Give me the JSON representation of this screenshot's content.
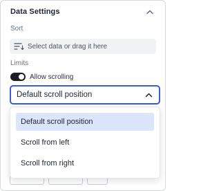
{
  "panel": {
    "title": "Data Settings"
  },
  "sort": {
    "label": "Sort",
    "placeholder": "Select data or drag it here"
  },
  "limits": {
    "label": "Limits",
    "allow_scrolling": {
      "label": "Allow scrolling",
      "enabled": true
    }
  },
  "scroll_select": {
    "value": "Default scroll position",
    "options": [
      {
        "label": "Default scroll position",
        "selected": true
      },
      {
        "label": "Scroll from left",
        "selected": false
      },
      {
        "label": "Scroll from right",
        "selected": false
      }
    ]
  },
  "icons": {
    "collapse": "chevron-up-icon",
    "sort": "sort-lines-icon",
    "select_open": "chevron-up-icon"
  },
  "colors": {
    "accent": "#3d5ad8",
    "selected_option_bg": "#dbe5fb",
    "toggle_on": "#1a1d24",
    "sort_row_bg": "#f1f2f4"
  }
}
